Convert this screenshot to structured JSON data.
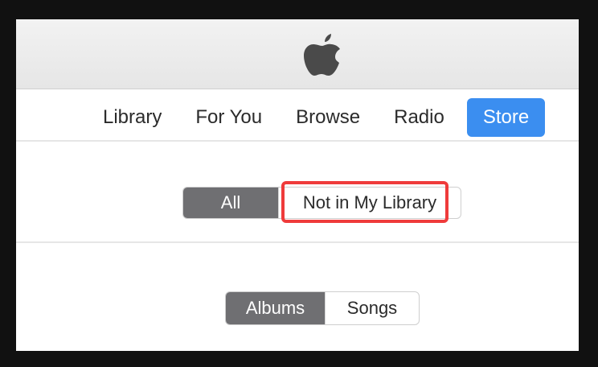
{
  "header": {
    "logo_icon": "apple-logo-icon"
  },
  "nav": {
    "items": [
      {
        "label": "Library"
      },
      {
        "label": "For You"
      },
      {
        "label": "Browse"
      },
      {
        "label": "Radio"
      },
      {
        "label": "Store",
        "active": true
      }
    ],
    "active_color": "#3b8ef0"
  },
  "filter": {
    "options": [
      {
        "label": "All",
        "selected": true
      },
      {
        "label": "Not in My Library",
        "selected": false
      }
    ],
    "highlight_color": "#ef3b3b"
  },
  "media_type": {
    "options": [
      {
        "label": "Albums",
        "selected": true
      },
      {
        "label": "Songs",
        "selected": false
      }
    ],
    "selected_color": "#6f6f72"
  }
}
